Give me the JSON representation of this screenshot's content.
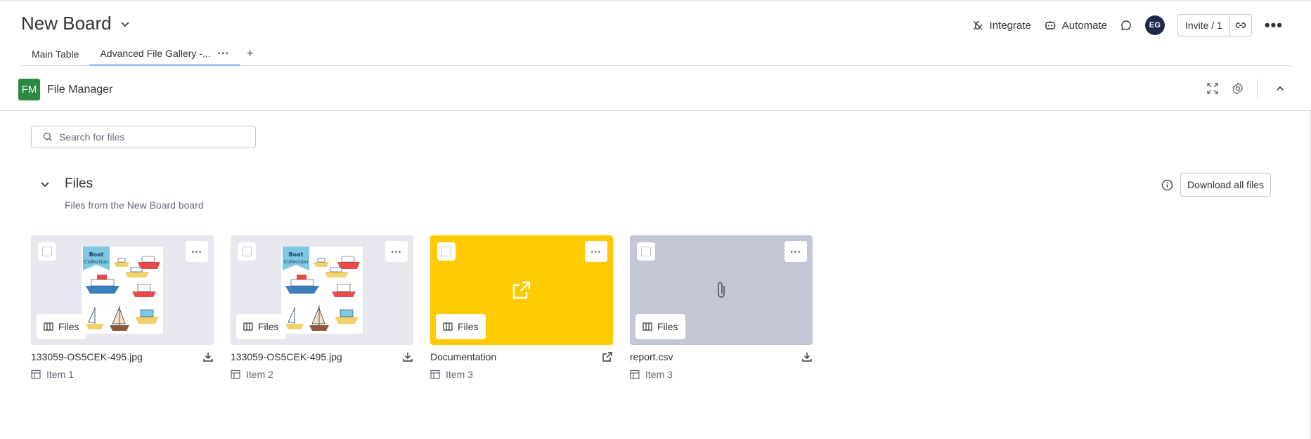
{
  "board": {
    "title": "New Board"
  },
  "header_actions": {
    "integrate": "Integrate",
    "automate": "Automate",
    "avatar_initials": "EG",
    "invite": "Invite / 1"
  },
  "tabs": [
    {
      "label": "Main Table"
    },
    {
      "label": "Advanced File Gallery -..."
    }
  ],
  "app": {
    "logo_text": "FM",
    "name": "File Manager"
  },
  "search": {
    "placeholder": "Search for files"
  },
  "section": {
    "title": "Files",
    "subtitle": "Files from the New Board board",
    "download_all": "Download all files"
  },
  "cards": [
    {
      "file_name": "133059-OS5CEK-495.jpg",
      "item": "Item 1",
      "chip": "Files",
      "kind": "image",
      "action_icon": "download-icon"
    },
    {
      "file_name": "133059-OS5CEK-495.jpg",
      "item": "Item 2",
      "chip": "Files",
      "kind": "image",
      "action_icon": "download-icon"
    },
    {
      "file_name": "Documentation",
      "item": "Item 3",
      "chip": "Files",
      "kind": "link",
      "thumb_color": "#ffcb00",
      "action_icon": "external-link-icon"
    },
    {
      "file_name": "report.csv",
      "item": "Item 3",
      "chip": "Files",
      "kind": "attachment",
      "thumb_color": "#c3c6d4",
      "action_icon": "download-icon"
    }
  ],
  "poster_text": "Boat Collection",
  "colors": {
    "accent": "#0073ea",
    "app_logo": "#2b8a3e",
    "avatar": "#1f2a4a"
  }
}
